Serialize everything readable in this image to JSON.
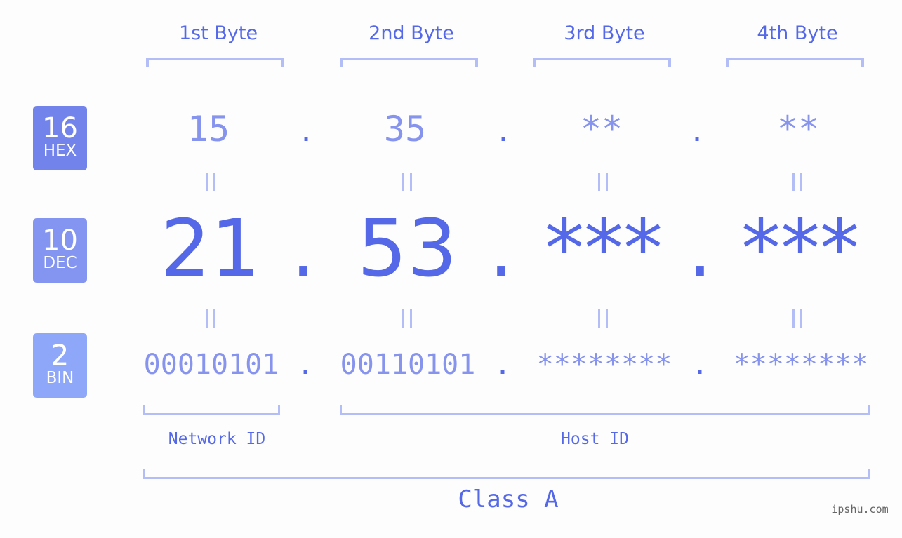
{
  "bytes_header": [
    "1st Byte",
    "2nd Byte",
    "3rd Byte",
    "4th Byte"
  ],
  "badges": [
    {
      "num": "16",
      "label": "HEX",
      "color": "#7383ec"
    },
    {
      "num": "10",
      "label": "DEC",
      "color": "#8494f1"
    },
    {
      "num": "2",
      "label": "BIN",
      "color": "#8fa7f8"
    }
  ],
  "hex": [
    "15",
    "35",
    "**",
    "**"
  ],
  "dec": [
    "21",
    "53",
    "***",
    "***"
  ],
  "bin": [
    "00010101",
    "00110101",
    "********",
    "********"
  ],
  "separator": ".",
  "equals": "=",
  "network_id_label": "Network ID",
  "host_id_label": "Host ID",
  "class_label": "Class A",
  "watermark": "ipshu.com",
  "colors": {
    "accent": "#5468e8",
    "light": "#8794ee",
    "bracket": "#b3bdf6"
  }
}
